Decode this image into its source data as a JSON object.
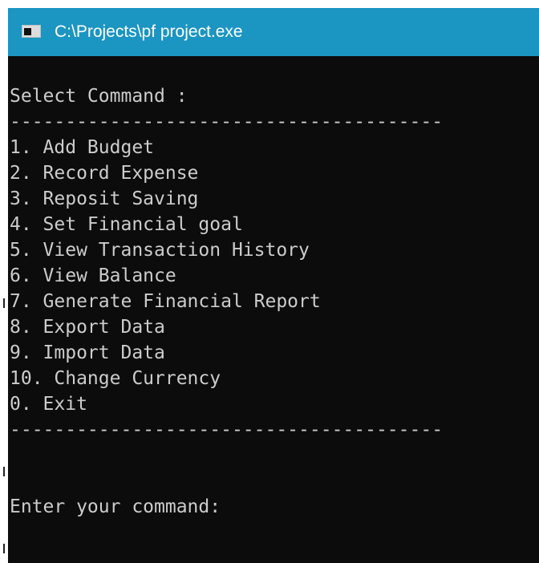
{
  "window": {
    "title": "C:\\Projects\\pf project.exe"
  },
  "console": {
    "prompt_header": "Select Command :",
    "separator_top": "---------------------------------------",
    "menu_items": [
      "1. Add Budget",
      "2. Record Expense",
      "3. Reposit Saving",
      "4. Set Financial goal",
      "5. View Transaction History",
      "6. View Balance",
      "7. Generate Financial Report",
      "8. Export Data",
      "9. Import Data",
      "10. Change Currency",
      "0. Exit"
    ],
    "separator_bottom": "---------------------------------------",
    "input_prompt": "Enter your command:"
  },
  "colors": {
    "titlebar": "#1b95c2",
    "console_bg": "#0c0c0c",
    "console_text": "#cccccc"
  },
  "icons": {
    "app_icon": "console-window-icon"
  }
}
